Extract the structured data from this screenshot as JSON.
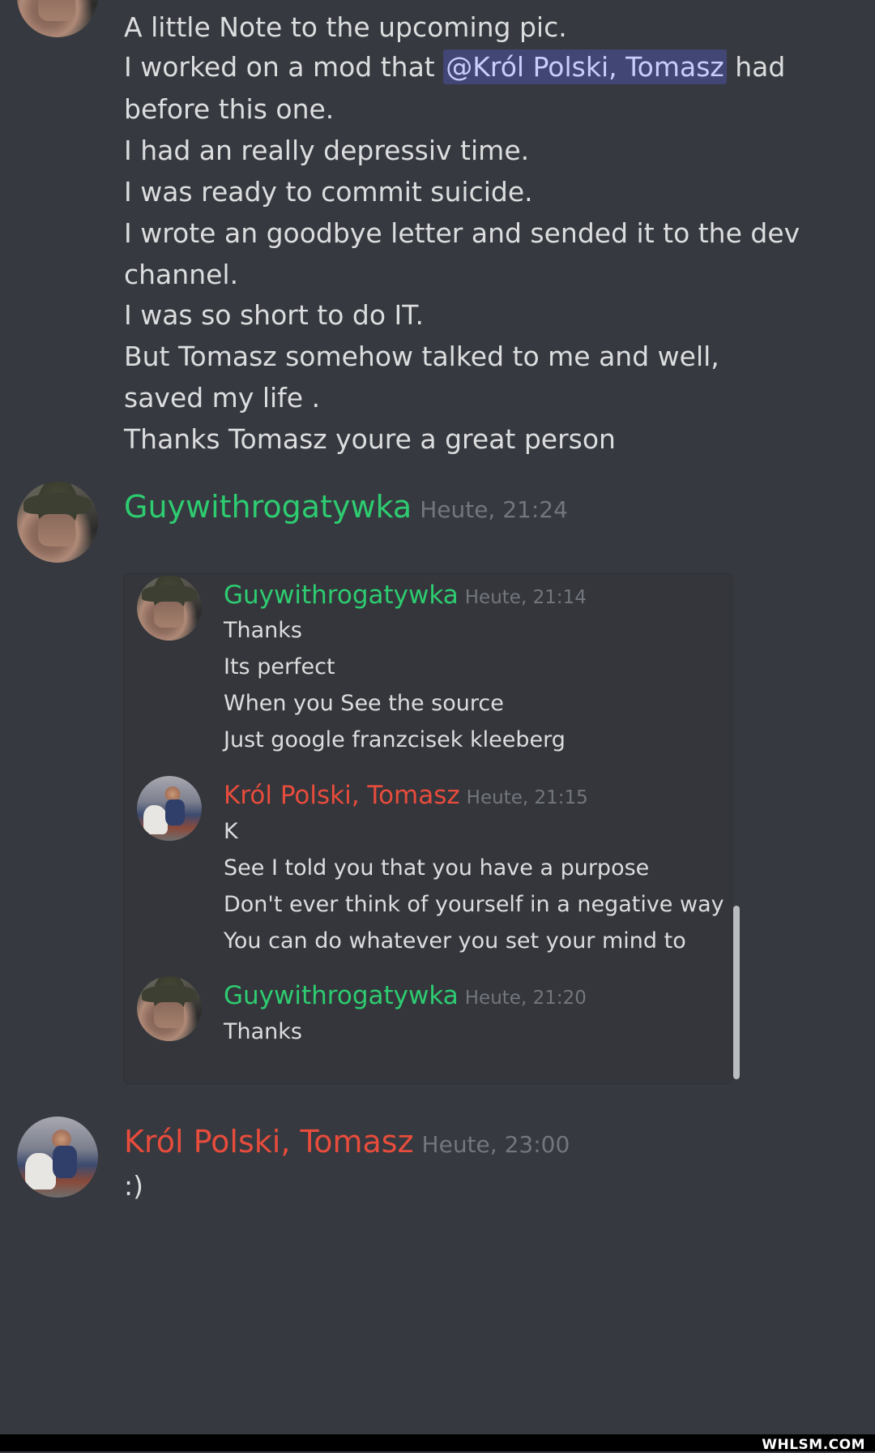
{
  "message_1": {
    "lines": [
      "A little Note to the upcoming pic.",
      "I worked on a mod that",
      "had",
      "before this one.",
      "I had an really depressiv time.",
      "I was ready to commit suicide.",
      "I wrote an goodbye letter and sended it to the dev",
      "channel.",
      "I was so short to do IT.",
      "But Tomasz somehow talked to me and well,",
      "saved my life .",
      "Thanks Tomasz youre a great person"
    ],
    "mention": "@Król Polski, Tomasz"
  },
  "message_2": {
    "author": "Guywithrogatywka",
    "time": "Heute, 21:24",
    "embed": {
      "messages": [
        {
          "author": "Guywithrogatywka",
          "time": "Heute, 21:14",
          "lines": [
            "Thanks",
            "Its perfect",
            "When you See the source",
            "Just google franzcisek kleeberg"
          ]
        },
        {
          "author": "Król Polski, Tomasz",
          "time": "Heute, 21:15",
          "lines": [
            "K",
            "See I told you that you have a purpose",
            "Don't ever think of yourself in a negative way",
            "You can do whatever you set your mind to"
          ]
        },
        {
          "author": "Guywithrogatywka",
          "time": "Heute, 21:20",
          "lines": [
            "Thanks"
          ]
        }
      ]
    }
  },
  "message_3": {
    "author": "Król Polski, Tomasz",
    "time": "Heute, 23:00",
    "text": ":)"
  },
  "watermark": "WHLSM.COM",
  "colors": {
    "background": "#36393f",
    "green_author": "#2ecc71",
    "red_author": "#e74c3c",
    "mention_bg": "#414675",
    "mention_text": "#c9cdfb"
  }
}
